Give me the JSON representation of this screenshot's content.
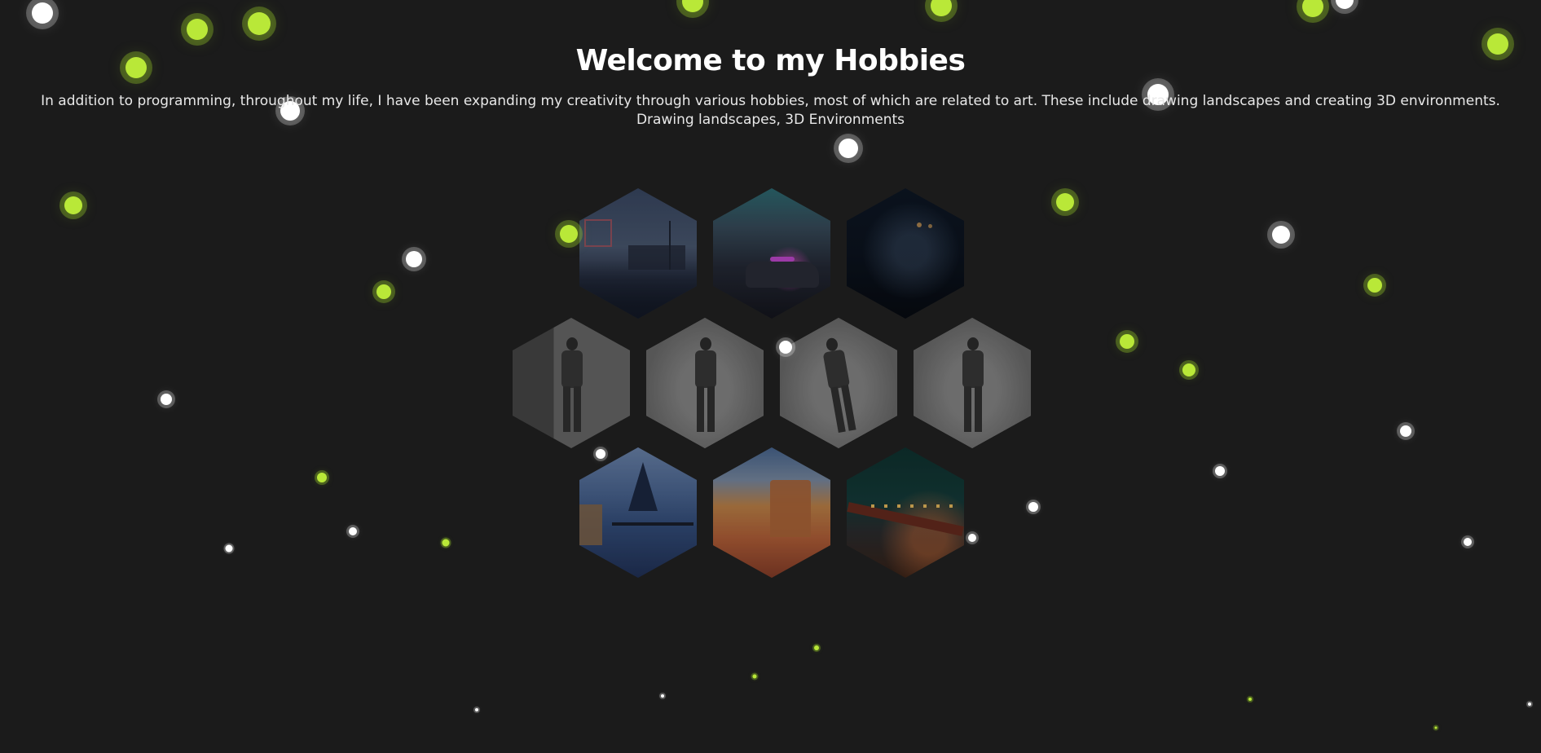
{
  "header": {
    "title": "Welcome to my Hobbies",
    "description": "In addition to programming, throughout my life, I have been expanding my creativity through various hobbies, most of which are related to art. These include drawing landscapes and creating 3D environments. Drawing landscapes, 3D Environments"
  },
  "colors": {
    "background": "#1b1b1b",
    "accent_green": "#b9e838",
    "particle_white": "#ffffff",
    "text": "#ffffff"
  },
  "gallery": {
    "items": [
      {
        "name": "motel-street-fog-render"
      },
      {
        "name": "police-car-night-render"
      },
      {
        "name": "dark-night-lake-render"
      },
      {
        "name": "sketch-man-with-jacket"
      },
      {
        "name": "sketch-armored-figure"
      },
      {
        "name": "sketch-running-figure"
      },
      {
        "name": "sketch-standing-figure"
      },
      {
        "name": "painting-snowy-cabin"
      },
      {
        "name": "painting-desert-canyon"
      },
      {
        "name": "painting-night-bridge"
      }
    ]
  }
}
